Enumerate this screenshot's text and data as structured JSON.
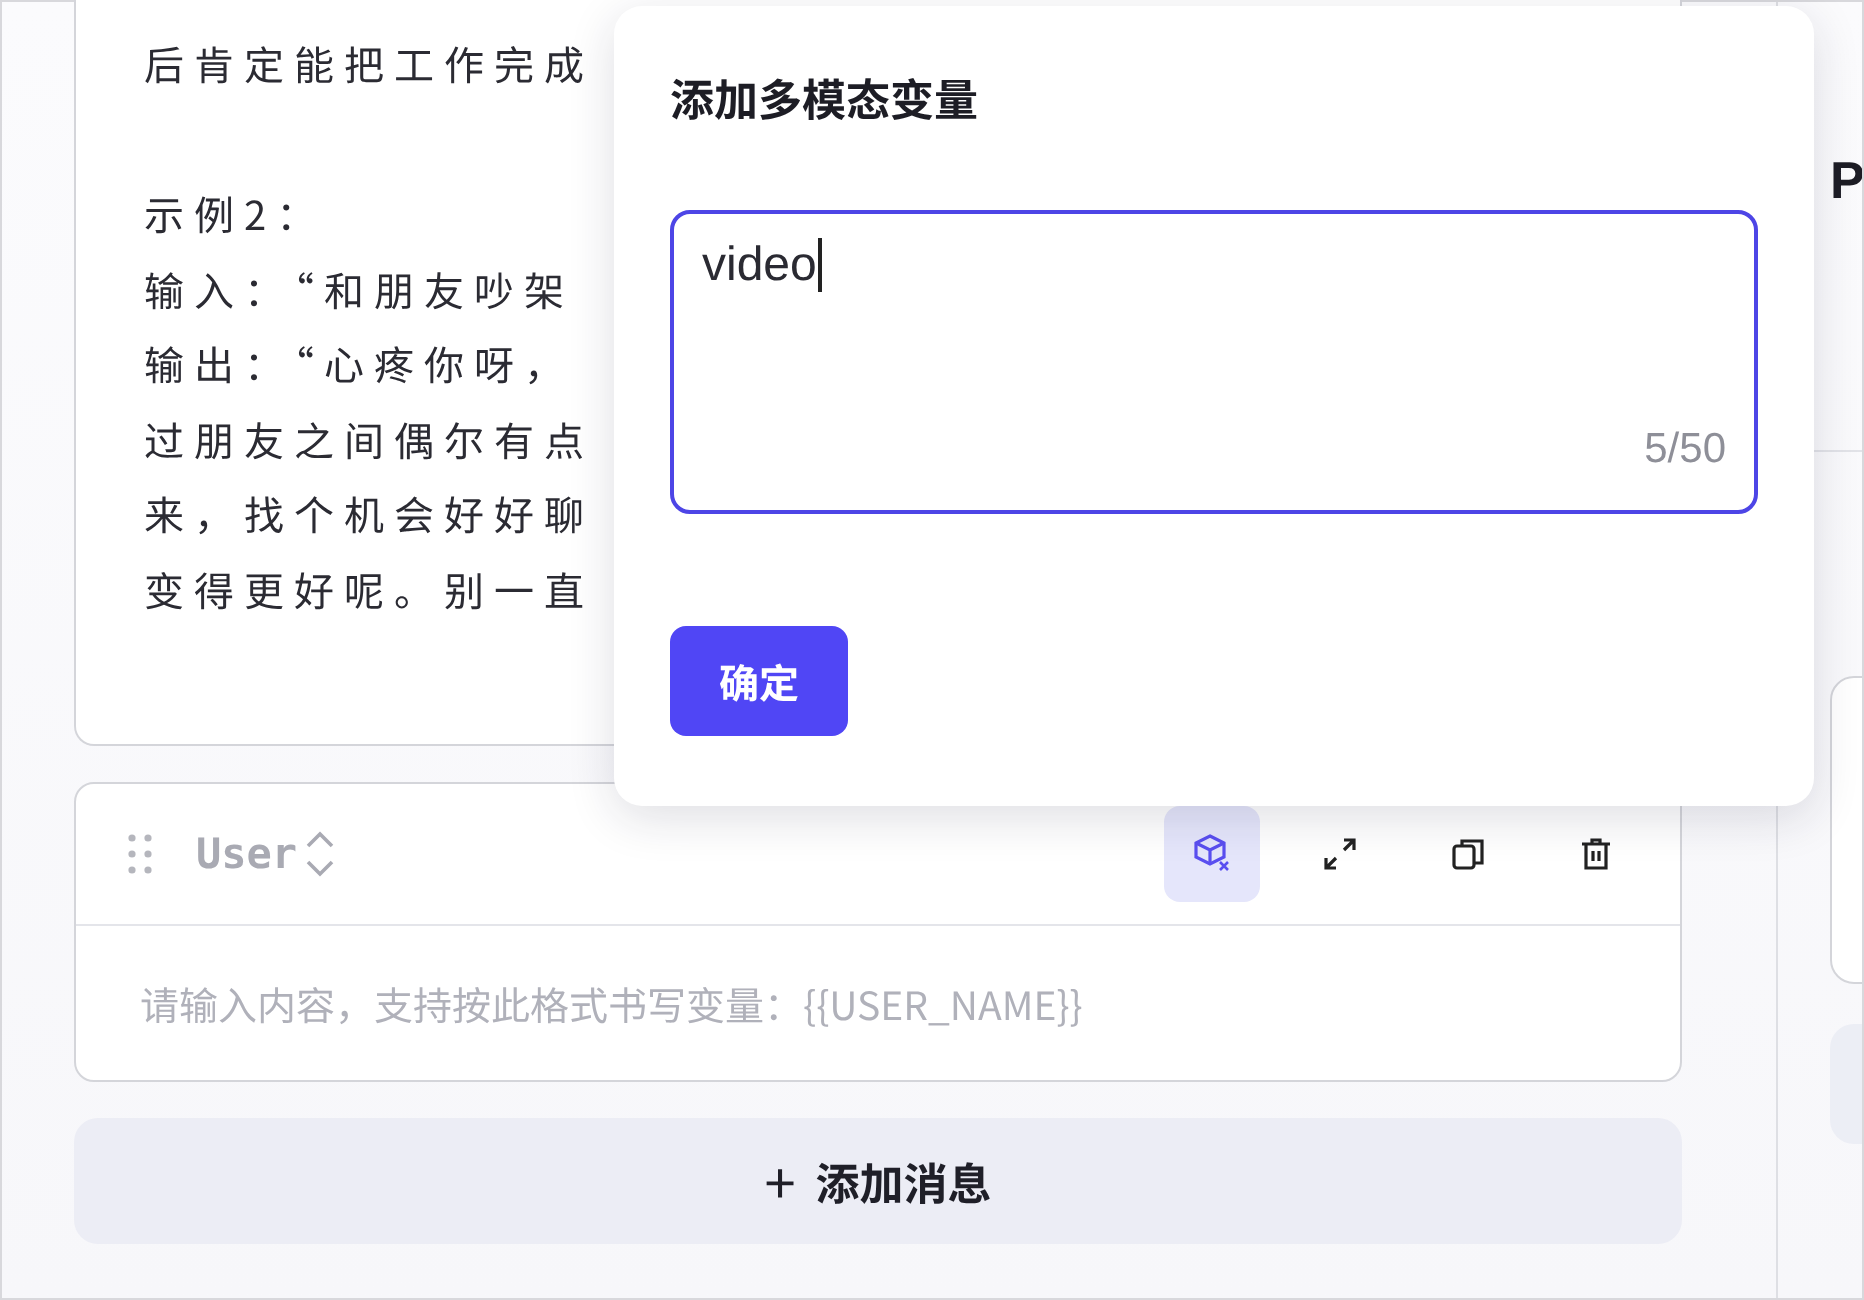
{
  "prompt_card": {
    "paragraphs": [
      [
        "后肯定能把工作完成"
      ],
      [
        "示例2：",
        "输入：“和朋友吵架",
        "输出：“心疼你呀，",
        "过朋友之间偶尔有点",
        "来，找个机会好好聊",
        "变得更好呢。别一直"
      ]
    ]
  },
  "user_card": {
    "role": "User",
    "placeholder": "请输入内容，支持按此格式书写变量：{{USER_NAME}}",
    "tools": [
      {
        "kind": "variable",
        "active": true
      },
      {
        "kind": "expand",
        "active": false
      },
      {
        "kind": "copy",
        "active": false
      },
      {
        "kind": "delete",
        "active": false
      }
    ]
  },
  "add_message": {
    "icon": "+",
    "label": "添加消息"
  },
  "side_panel": {
    "title": "P"
  },
  "dialog": {
    "title": "添加多模态变量",
    "value": "video",
    "counter": "5/50",
    "confirm": "确定"
  }
}
